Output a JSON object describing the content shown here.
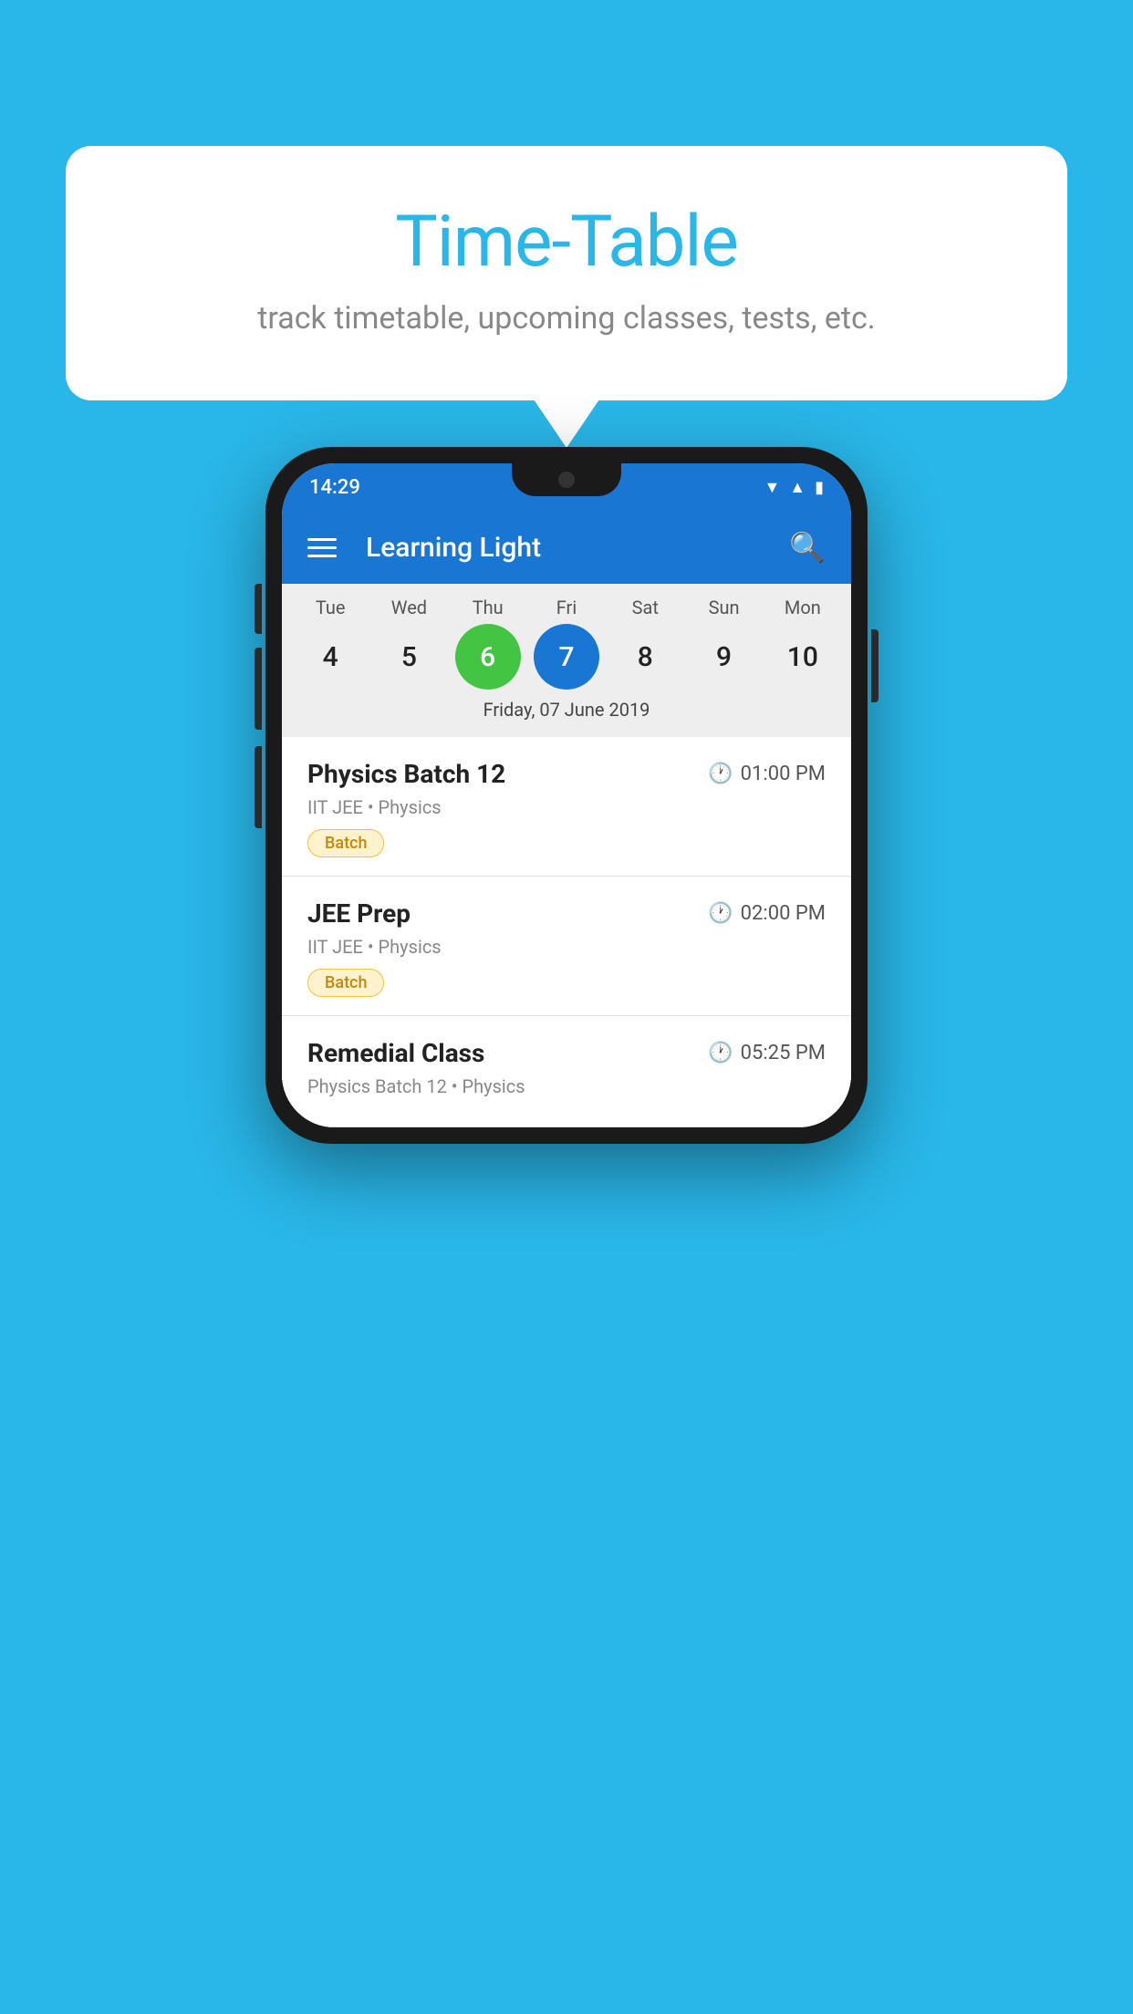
{
  "background_color": "#29b6e8",
  "speech_bubble": {
    "title": "Time-Table",
    "subtitle": "track timetable, upcoming classes, tests, etc."
  },
  "phone": {
    "status_bar": {
      "time": "14:29",
      "icons": [
        "wifi",
        "signal",
        "battery"
      ]
    },
    "app_bar": {
      "title": "Learning Light",
      "hamburger_label": "menu",
      "search_label": "search"
    },
    "calendar": {
      "days": [
        {
          "label": "Tue",
          "num": "4"
        },
        {
          "label": "Wed",
          "num": "5"
        },
        {
          "label": "Thu",
          "num": "6",
          "state": "today"
        },
        {
          "label": "Fri",
          "num": "7",
          "state": "selected"
        },
        {
          "label": "Sat",
          "num": "8"
        },
        {
          "label": "Sun",
          "num": "9"
        },
        {
          "label": "Mon",
          "num": "10"
        }
      ],
      "selected_date_label": "Friday, 07 June 2019"
    },
    "schedule": [
      {
        "title": "Physics Batch 12",
        "time": "01:00 PM",
        "subtitle": "IIT JEE • Physics",
        "tag": "Batch"
      },
      {
        "title": "JEE Prep",
        "time": "02:00 PM",
        "subtitle": "IIT JEE • Physics",
        "tag": "Batch"
      },
      {
        "title": "Remedial Class",
        "time": "05:25 PM",
        "subtitle": "Physics Batch 12 • Physics",
        "tag": ""
      }
    ]
  }
}
